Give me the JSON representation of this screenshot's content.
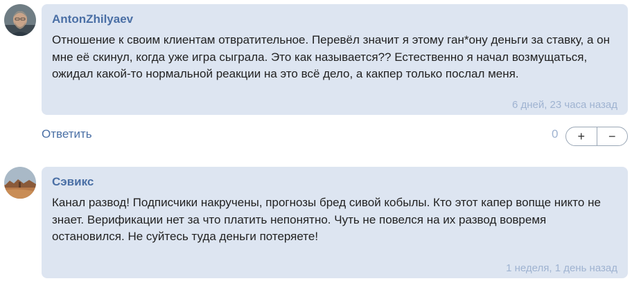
{
  "comments": [
    {
      "author": "AntonZhilyaev",
      "avatar": "man-portrait-avatar",
      "text": "Отношение к своим клиентам отвратительное. Перевёл значит я этому ган*ону деньги за ставку, а он мне её скинул, когда уже игра сыграла. Это как называется?? Естественно я начал возмущаться, ожидал какой-то нормальной реакции на это всё дело, а какпер только послал меня.",
      "time": "6 дней, 23 часа назад"
    },
    {
      "author": "Сэвикс",
      "avatar": "desert-landscape-avatar",
      "text": "Канал развод! Подписчики накручены, прогнозы бред сивой кобылы. Кто этот капер вопще никто не знает. Верификации нет за что платить непонятно. Чуть не повелся на их развод вовремя остановился. Не суйтесь туда деньги потеряете!",
      "time": "1 неделя, 1 день назад"
    }
  ],
  "actions": {
    "reply_label": "Ответить",
    "score": "0",
    "upvote": "+",
    "downvote": "−"
  },
  "colors": {
    "bubble_bg": "#dde5f1",
    "author": "#4a6fa5",
    "time": "#9fb3d1"
  }
}
